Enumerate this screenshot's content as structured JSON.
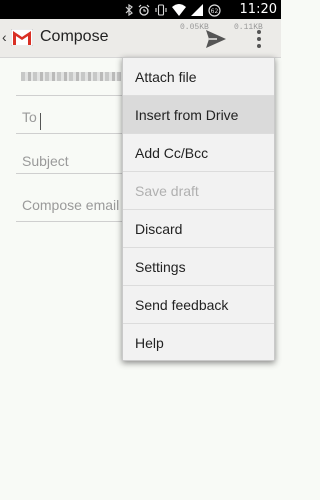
{
  "status_bar": {
    "time": "11:20",
    "icons": [
      "bluetooth-icon",
      "alarm-icon",
      "vibrate-icon",
      "wifi-icon",
      "signal-icon",
      "battery-icon"
    ]
  },
  "action_bar": {
    "title": "Compose",
    "download_speed": "0.05KB",
    "upload_speed": "0.11KB"
  },
  "form": {
    "to_label": "To",
    "subject_placeholder": "Subject",
    "body_placeholder": "Compose email"
  },
  "menu": {
    "items": [
      {
        "label": "Attach file"
      },
      {
        "label": "Insert from Drive"
      },
      {
        "label": "Add Cc/Bcc"
      },
      {
        "label": "Save draft"
      },
      {
        "label": "Discard"
      },
      {
        "label": "Settings"
      },
      {
        "label": "Send feedback"
      },
      {
        "label": "Help"
      }
    ]
  },
  "colors": {
    "gmail_red": "#d93025",
    "menu_bg": "#f2f2f2",
    "highlight_bg": "#dadada",
    "disabled_text": "#b0b0b0"
  }
}
